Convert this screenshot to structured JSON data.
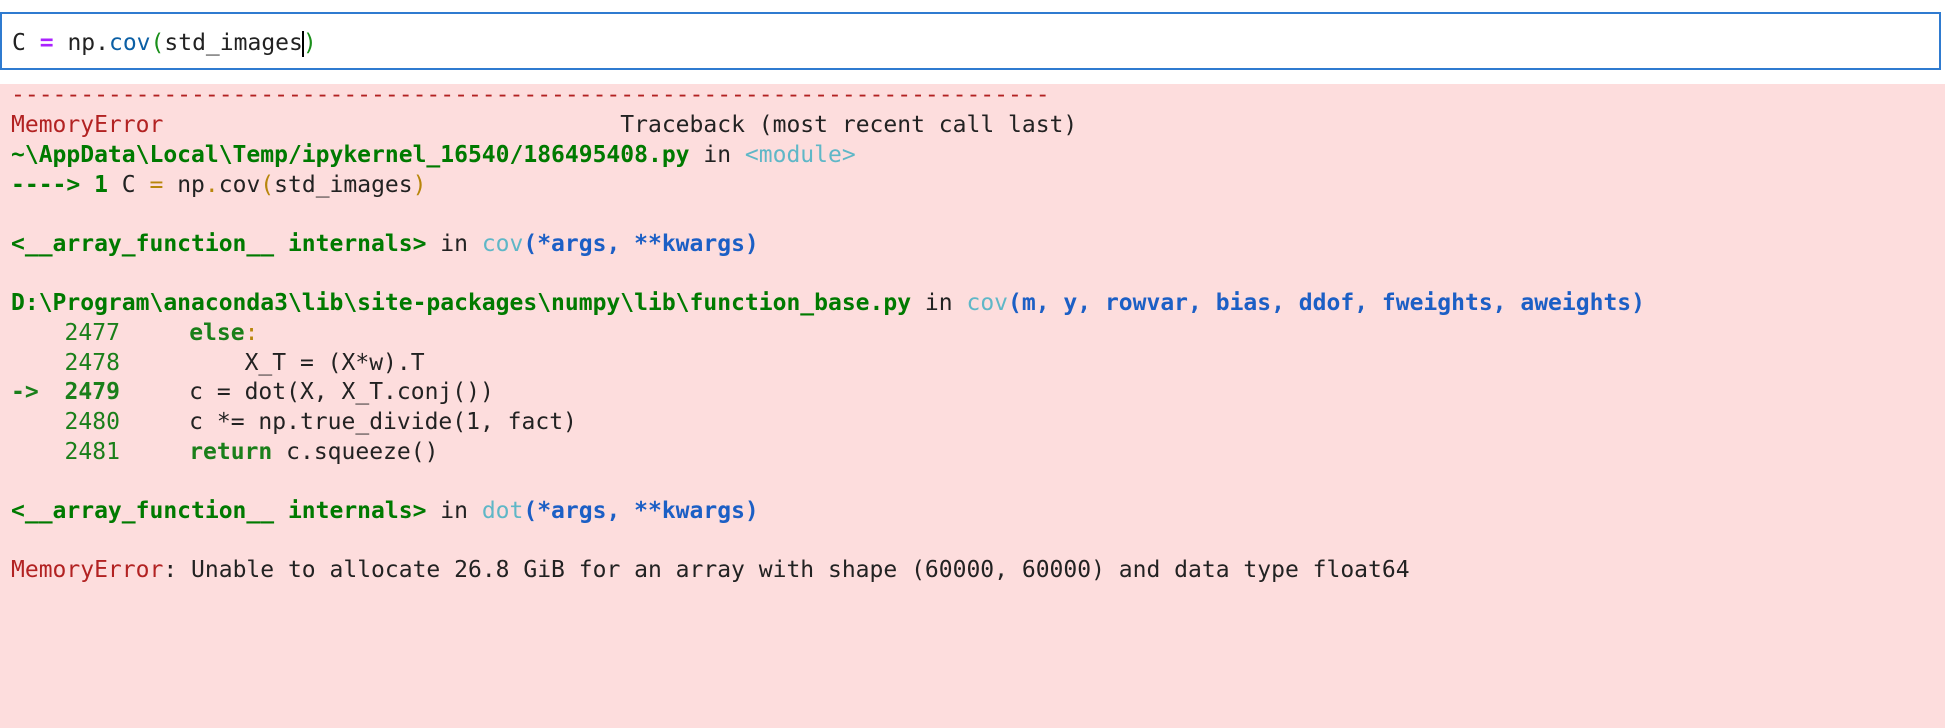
{
  "input": {
    "code_var": "C",
    "code_eq": "=",
    "code_mod": "np.",
    "code_fn": "cov",
    "code_open": "(",
    "code_arg": "std_images",
    "code_close": ")"
  },
  "traceback": {
    "dash_line": "---------------------------------------------------------------------------",
    "error_name": "MemoryError",
    "header_right": "Traceback (most recent call last)",
    "frame1": {
      "path": "~\\AppData\\Local\\Temp/ipykernel_16540/186495408.py",
      "in_word": " in ",
      "scope": "<module>",
      "arrow": "----> 1",
      "code_a": " C ",
      "code_eq": "=",
      "code_b": " np",
      "code_dot": ".",
      "code_c": "cov",
      "code_p1": "(",
      "code_d": "std_images",
      "code_p2": ")"
    },
    "frame2": {
      "path": "<__array_function__ internals>",
      "in_word": " in ",
      "fn": "cov",
      "args": "(*args, **kwargs)"
    },
    "frame3": {
      "path": "D:\\Program\\anaconda3\\lib\\site-packages\\numpy\\lib\\function_base.py",
      "in_word": " in ",
      "fn": "cov",
      "args": "(m, y, rowvar, bias, ddof, fweights, aweights)",
      "lines": [
        {
          "no": "2477",
          "arrow": "   ",
          "text_kw": "else",
          "text_rest": ":"
        },
        {
          "no": "2478",
          "arrow": "   ",
          "text": "        X_T = (X*w).T"
        },
        {
          "no": "2479",
          "arrow": "-> ",
          "text": "    c = dot(X, X_T.conj())"
        },
        {
          "no": "2480",
          "arrow": "   ",
          "text": "    c *= np.true_divide(1, fact)"
        },
        {
          "no": "2481",
          "arrow": "   ",
          "text_kw": "return",
          "text_rest": " c.squeeze()"
        }
      ]
    },
    "frame4": {
      "path": "<__array_function__ internals>",
      "in_word": " in ",
      "fn": "dot",
      "args": "(*args, **kwargs)"
    },
    "final": {
      "error_name": "MemoryError",
      "message": ": Unable to allocate 26.8 GiB for an array with shape (60000, 60000) and data type float64"
    }
  }
}
